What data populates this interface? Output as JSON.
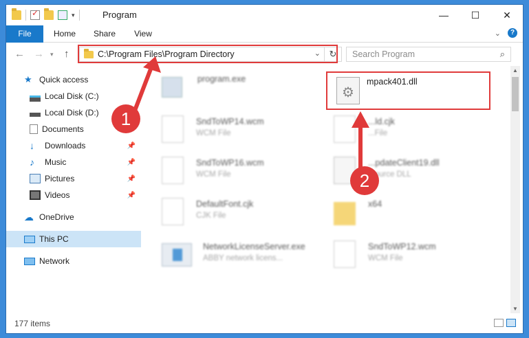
{
  "window": {
    "title": "Program",
    "controls": {
      "minimize": "—",
      "maximize": "☐",
      "close": "✕"
    }
  },
  "ribbon": {
    "tabs": [
      "File",
      "Home",
      "Share",
      "View"
    ]
  },
  "address": {
    "path": "C:\\Program Files\\Program Directory",
    "search_placeholder": "Search Program"
  },
  "nav": {
    "items": [
      {
        "label": "Quick access",
        "icon": "star-icon"
      },
      {
        "label": "Local Disk (C:)",
        "icon": "drive-icon"
      },
      {
        "label": "Local Disk (D:)",
        "icon": "drive-icon"
      },
      {
        "label": "Documents",
        "icon": "documents-icon"
      },
      {
        "label": "Downloads",
        "icon": "downloads-icon"
      },
      {
        "label": "Music",
        "icon": "music-icon"
      },
      {
        "label": "Pictures",
        "icon": "pictures-icon"
      },
      {
        "label": "Videos",
        "icon": "videos-icon"
      },
      {
        "label": "OneDrive",
        "icon": "cloud-icon"
      },
      {
        "label": "This PC",
        "icon": "computer-icon"
      },
      {
        "label": "Network",
        "icon": "network-icon"
      }
    ]
  },
  "files": [
    {
      "name": "program.exe",
      "type": ""
    },
    {
      "name": "mpack401.dll",
      "type": ""
    },
    {
      "name": "SndToWP14.wcm",
      "type": "WCM File"
    },
    {
      "name": "...ld.cjk",
      "type": "...File"
    },
    {
      "name": "SndToWP16.wcm",
      "type": "WCM File"
    },
    {
      "name": "...pdateClient19.dll",
      "type": "...ource DLL"
    },
    {
      "name": "DefaultFont.cjk",
      "type": "CJK File"
    },
    {
      "name": "x64",
      "type": ""
    },
    {
      "name": "NetworkLicenseServer.exe",
      "type": "ABBY network licens..."
    },
    {
      "name": "SndToWP12.wcm",
      "type": "WCM File"
    }
  ],
  "annotations": {
    "badge1": "1",
    "badge2": "2"
  },
  "status": {
    "count": "177 items"
  },
  "colors": {
    "accent": "#1979ca",
    "highlight": "#e03a3a",
    "desktop": "#3d8bd9"
  }
}
